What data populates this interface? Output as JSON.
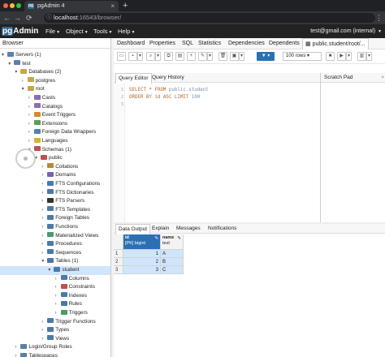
{
  "browser": {
    "tab_title": "pgAdmin 4",
    "url_host": "localhost",
    "url_rest": ":16543/browser/",
    "close_glyph": "×",
    "new_tab_glyph": "+"
  },
  "navbar": {
    "logo_pg": "pg",
    "logo_rest": "Admin",
    "menus": [
      "File",
      "Object",
      "Tools",
      "Help"
    ],
    "user": "test@gmail.com (internal)"
  },
  "left_panel": {
    "title": "Browser",
    "tree": [
      {
        "label": "Servers (1)",
        "level": 0,
        "open": true,
        "icon": "servers-icon",
        "color": "#5a7fa8"
      },
      {
        "label": "test",
        "level": 1,
        "open": true,
        "icon": "server-icon",
        "color": "#5a7fa8"
      },
      {
        "label": "Databases (2)",
        "level": 2,
        "open": true,
        "icon": "databases-icon",
        "color": "#c9a54a"
      },
      {
        "label": "postgres",
        "level": 3,
        "open": false,
        "icon": "database-icon",
        "color": "#c9a54a"
      },
      {
        "label": "root",
        "level": 3,
        "open": true,
        "icon": "database-icon",
        "color": "#c9a54a"
      },
      {
        "label": "Casts",
        "level": 4,
        "open": false,
        "icon": "casts-icon",
        "color": "#8a6db1"
      },
      {
        "label": "Catalogs",
        "level": 4,
        "open": false,
        "icon": "catalogs-icon",
        "color": "#8a6db1"
      },
      {
        "label": "Event Triggers",
        "level": 4,
        "open": false,
        "icon": "event-triggers-icon",
        "color": "#d48a2c"
      },
      {
        "label": "Extensions",
        "level": 4,
        "open": false,
        "icon": "extensions-icon",
        "color": "#5b9e5b"
      },
      {
        "label": "Foreign Data Wrappers",
        "level": 4,
        "open": false,
        "icon": "fdw-icon",
        "color": "#5a7fa8"
      },
      {
        "label": "Languages",
        "level": 4,
        "open": false,
        "icon": "languages-icon",
        "color": "#d4b22c"
      },
      {
        "label": "Schemas (1)",
        "level": 4,
        "open": true,
        "icon": "schemas-icon",
        "color": "#c0504d"
      },
      {
        "label": "public",
        "level": 5,
        "open": true,
        "icon": "schema-icon",
        "color": "#c0504d"
      },
      {
        "label": "Collations",
        "level": 6,
        "open": false,
        "icon": "collations-icon",
        "color": "#b58b2d"
      },
      {
        "label": "Domains",
        "level": 6,
        "open": false,
        "icon": "domains-icon",
        "color": "#7a62a8"
      },
      {
        "label": "FTS Configurations",
        "level": 6,
        "open": false,
        "icon": "fts-config-icon",
        "color": "#4a7aa8"
      },
      {
        "label": "FTS Dictionaries",
        "level": 6,
        "open": false,
        "icon": "fts-dict-icon",
        "color": "#4a7aa8"
      },
      {
        "label": "FTS Parsers",
        "level": 6,
        "open": false,
        "icon": "fts-parsers-icon",
        "color": "#333333"
      },
      {
        "label": "FTS Templates",
        "level": 6,
        "open": false,
        "icon": "fts-templates-icon",
        "color": "#4a7aa8"
      },
      {
        "label": "Foreign Tables",
        "level": 6,
        "open": false,
        "icon": "foreign-tables-icon",
        "color": "#4a7aa8"
      },
      {
        "label": "Functions",
        "level": 6,
        "open": false,
        "icon": "functions-icon",
        "color": "#4a7aa8"
      },
      {
        "label": "Materialized Views",
        "level": 6,
        "open": false,
        "icon": "mviews-icon",
        "color": "#4a9a6a"
      },
      {
        "label": "Procedures",
        "level": 6,
        "open": false,
        "icon": "procedures-icon",
        "color": "#4a7aa8"
      },
      {
        "label": "Sequences",
        "level": 6,
        "open": false,
        "icon": "sequences-icon",
        "color": "#4a7aa8"
      },
      {
        "label": "Tables (1)",
        "level": 6,
        "open": true,
        "icon": "tables-icon",
        "color": "#4a7aa8"
      },
      {
        "label": "student",
        "level": 7,
        "open": true,
        "icon": "table-icon",
        "color": "#4a7aa8",
        "selected": true
      },
      {
        "label": "Columns",
        "level": 8,
        "open": false,
        "icon": "columns-icon",
        "color": "#4a7aa8"
      },
      {
        "label": "Constraints",
        "level": 8,
        "open": false,
        "icon": "constraints-icon",
        "color": "#c0504d"
      },
      {
        "label": "Indexes",
        "level": 8,
        "open": false,
        "icon": "indexes-icon",
        "color": "#4a7aa8"
      },
      {
        "label": "Rules",
        "level": 8,
        "open": false,
        "icon": "rules-icon",
        "color": "#4a7aa8"
      },
      {
        "label": "Triggers",
        "level": 8,
        "open": false,
        "icon": "triggers-icon",
        "color": "#4a9a6a"
      },
      {
        "label": "Trigger Functions",
        "level": 6,
        "open": false,
        "icon": "trigger-functions-icon",
        "color": "#4a7aa8"
      },
      {
        "label": "Types",
        "level": 6,
        "open": false,
        "icon": "types-icon",
        "color": "#4a7aa8"
      },
      {
        "label": "Views",
        "level": 6,
        "open": false,
        "icon": "views-icon",
        "color": "#4a7aa8"
      },
      {
        "label": "Login/Group Roles",
        "level": 2,
        "open": false,
        "icon": "roles-icon",
        "color": "#5a7fa8"
      },
      {
        "label": "Tablespaces",
        "level": 2,
        "open": false,
        "icon": "tablespaces-icon",
        "color": "#5a7fa8"
      }
    ]
  },
  "main_tabs": [
    "Dashboard",
    "Properties",
    "SQL",
    "Statistics",
    "Dependencies",
    "Dependents",
    "public.student/root/..."
  ],
  "toolbar": {
    "rows_select": "100 rows"
  },
  "editor_tabs": [
    "Query Editor",
    "Query History"
  ],
  "scratch_pad": {
    "title": "Scratch Pad",
    "close": "×"
  },
  "editor": {
    "lines": [
      {
        "n": "1",
        "kw1": "SELECT * FROM ",
        "id1": "public.student",
        "rest": ""
      },
      {
        "n": "2",
        "kw1": "ORDER BY id ASC LIMIT ",
        "id1": "100",
        "rest": ""
      },
      {
        "n": "3",
        "kw1": "",
        "id1": "",
        "rest": ""
      }
    ]
  },
  "output_tabs": [
    "Data Output",
    "Explain",
    "Messages",
    "Notifications"
  ],
  "result": {
    "columns": [
      {
        "name": "id",
        "type": "[PK] bigint"
      },
      {
        "name": "name",
        "type": "text"
      }
    ],
    "rows": [
      {
        "row": "1",
        "id": "1",
        "name": "A"
      },
      {
        "row": "2",
        "id": "2",
        "name": "B"
      },
      {
        "row": "3",
        "id": "3",
        "name": "C"
      }
    ]
  }
}
